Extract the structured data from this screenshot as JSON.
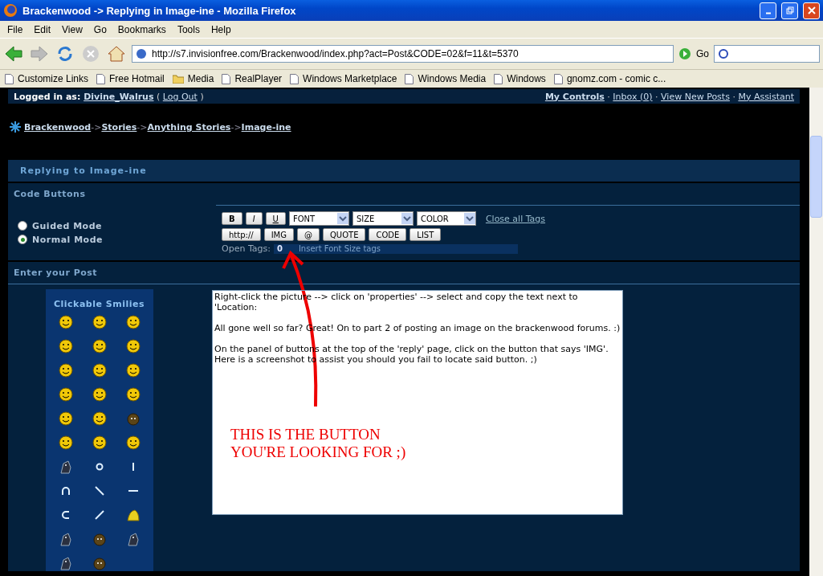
{
  "window": {
    "title": "Brackenwood -> Replying in Image-ine - Mozilla Firefox"
  },
  "menu": [
    "File",
    "Edit",
    "View",
    "Go",
    "Bookmarks",
    "Tools",
    "Help"
  ],
  "toolbar": {
    "address": "http://s7.invisionfree.com/Brackenwood/index.php?act=Post&CODE=02&f=11&t=5370",
    "go": "Go"
  },
  "bookmarks": [
    {
      "label": "Customize Links",
      "kind": "page"
    },
    {
      "label": "Free Hotmail",
      "kind": "page"
    },
    {
      "label": "Media",
      "kind": "folder"
    },
    {
      "label": "RealPlayer",
      "kind": "page"
    },
    {
      "label": "Windows Marketplace",
      "kind": "page"
    },
    {
      "label": "Windows Media",
      "kind": "page"
    },
    {
      "label": "Windows",
      "kind": "page"
    },
    {
      "label": "gnomz.com - comic c...",
      "kind": "page"
    }
  ],
  "user_bar": {
    "label": "Logged in as:",
    "username": "Divine_Walrus",
    "open_paren": "(",
    "logout": "Log Out",
    "close_paren": ")",
    "separator": "·",
    "links": [
      "My Controls",
      "Inbox (0)",
      "View New Posts",
      "My Assistant"
    ]
  },
  "breadcrumb_separator": "->",
  "breadcrumb": [
    "Brackenwood",
    "Stories",
    "Anything Stories",
    "Image-ine"
  ],
  "panel": {
    "title": "Replying to Image-ine",
    "code_buttons_header": "Code Buttons",
    "modes": [
      {
        "label": "Guided Mode",
        "selected": false
      },
      {
        "label": "Normal Mode",
        "selected": true
      }
    ],
    "format_buttons": [
      "B",
      "I",
      "U"
    ],
    "dropdowns": [
      "FONT",
      "SIZE",
      "COLOR"
    ],
    "close_all": "Close all Tags",
    "tag_buttons": [
      "http://",
      "IMG",
      "@",
      "QUOTE",
      "CODE",
      "LIST"
    ],
    "open_tags_label": "Open Tags:",
    "open_tags_count": "0",
    "hint": "Insert Font Size tags",
    "enter_post_header": "Enter your Post",
    "smilies_title": "Clickable Smilies",
    "smilies": [
      {
        "kind": "face"
      },
      {
        "kind": "face"
      },
      {
        "kind": "face"
      },
      {
        "kind": "face"
      },
      {
        "kind": "face"
      },
      {
        "kind": "face"
      },
      {
        "kind": "face"
      },
      {
        "kind": "face"
      },
      {
        "kind": "face"
      },
      {
        "kind": "face"
      },
      {
        "kind": "face"
      },
      {
        "kind": "face"
      },
      {
        "kind": "face"
      },
      {
        "kind": "face"
      },
      {
        "kind": "monster"
      },
      {
        "kind": "face"
      },
      {
        "kind": "face"
      },
      {
        "kind": "face"
      },
      {
        "kind": "creature"
      },
      {
        "kind": "ring"
      },
      {
        "kind": "bar"
      },
      {
        "kind": "arch"
      },
      {
        "kind": "backslash"
      },
      {
        "kind": "dash"
      },
      {
        "kind": "hook"
      },
      {
        "kind": "slash"
      },
      {
        "kind": "bird"
      },
      {
        "kind": "creature"
      },
      {
        "kind": "monster"
      },
      {
        "kind": "creature"
      },
      {
        "kind": "creature"
      },
      {
        "kind": "monster"
      }
    ],
    "post": "Right-click the picture --> click on 'properties' --> select and copy the text next to 'Location:\n\nAll gone well so far? Great! On to part 2 of posting an image on the brackenwood forums. :)\n\nOn the panel of buttons at the top of the 'reply' page, click on the button that says 'IMG'. Here is a screenshot to assist you should you fail to locate said button. ;)\n"
  },
  "annotation": {
    "lines": [
      "THIS IS THE BUTTON",
      "YOU'RE LOOKING FOR ;)"
    ]
  }
}
